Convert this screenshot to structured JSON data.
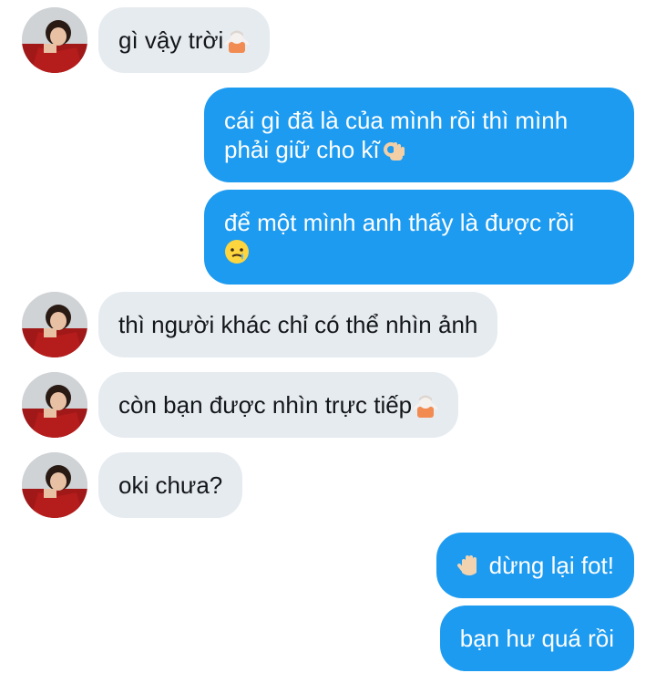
{
  "conversation": {
    "messages": [
      {
        "side": "in",
        "text": "gì vậy trời",
        "emoji": "person-shrugging-emoji"
      },
      {
        "side": "out",
        "line1": "cái gì đã là của mình rồi thì mình",
        "line2": "phải giữ cho kĩ",
        "emoji": "ok-hand-emoji"
      },
      {
        "side": "out",
        "line1": "để một mình anh thấy là được rồi",
        "emoji": "face-holding-back-tears-emoji"
      },
      {
        "side": "in",
        "text": "thì người khác chỉ có thể nhìn ảnh"
      },
      {
        "side": "in",
        "text": "còn bạn được nhìn trực tiếp",
        "emoji": "person-shrugging-emoji"
      },
      {
        "side": "in",
        "text": "oki chưa?"
      },
      {
        "side": "out",
        "text": "dừng lại fot!",
        "emoji": "raised-hand-emoji"
      },
      {
        "side": "out",
        "text": "bạn hư quá rồi"
      }
    ]
  },
  "colors": {
    "incoming_bubble": "#e6ebf0",
    "outgoing_bubble": "#1d9bf0",
    "incoming_text": "#14171a",
    "outgoing_text": "#ffffff"
  }
}
